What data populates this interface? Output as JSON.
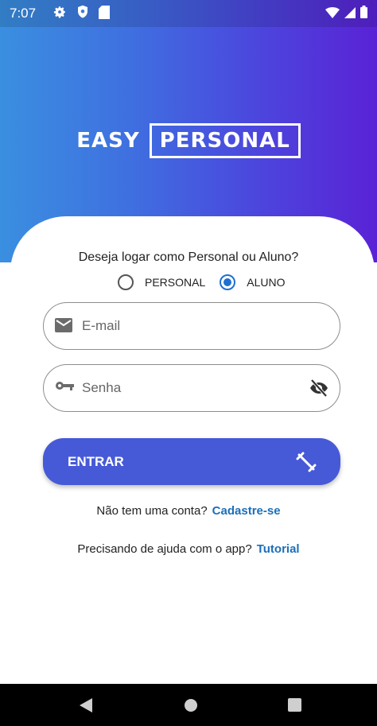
{
  "status_bar": {
    "time": "7:07",
    "left_icons": [
      "settings-icon",
      "shield-icon",
      "sd-card-icon"
    ],
    "right_icons": [
      "wifi-icon",
      "signal-icon",
      "battery-icon"
    ]
  },
  "logo": {
    "word1": "EASY",
    "word2": "PERSONAL"
  },
  "login": {
    "question": "Deseja logar como Personal ou Aluno?",
    "roles": [
      {
        "label": "PERSONAL",
        "selected": false
      },
      {
        "label": "ALUNO",
        "selected": true
      }
    ],
    "email_placeholder": "E-mail",
    "password_placeholder": "Senha",
    "submit_label": "ENTRAR"
  },
  "signup": {
    "prompt": "Não tem uma conta?",
    "link": "Cadastre-se"
  },
  "help": {
    "prompt": "Precisando de ajuda com o app?",
    "link": "Tutorial"
  },
  "colors": {
    "gradient_start": "#3a8fe0",
    "gradient_end": "#5a22d6",
    "button": "#465ad7",
    "link": "#1b6fba",
    "radio_selected": "#1f6fd1"
  },
  "nav_bar": {
    "icons": [
      "back-icon",
      "home-icon",
      "recents-icon"
    ]
  }
}
